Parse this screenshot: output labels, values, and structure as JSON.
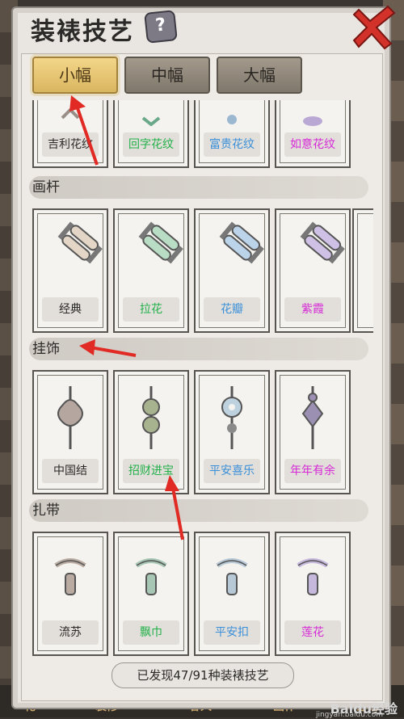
{
  "title": "装裱技艺",
  "help_symbol": "?",
  "tabs": [
    {
      "label": "小幅",
      "active": true
    },
    {
      "label": "中幅",
      "active": false
    },
    {
      "label": "大幅",
      "active": false
    }
  ],
  "top_row": [
    {
      "name": "吉利花纹",
      "color": "#2c2a28"
    },
    {
      "name": "回字花纹",
      "color": "#23b04a"
    },
    {
      "name": "富贵花纹",
      "color": "#3a8fd8"
    },
    {
      "name": "如意花纹",
      "color": "#d62ad6"
    }
  ],
  "sections": [
    {
      "label": "画杆",
      "items": [
        {
          "name": "经典",
          "color": "#2c2a28",
          "art": "rod",
          "tint": "#e3d6c6"
        },
        {
          "name": "拉花",
          "color": "#23b04a",
          "art": "rod",
          "tint": "#b8dcc4"
        },
        {
          "name": "花瓣",
          "color": "#3a8fd8",
          "art": "rod",
          "tint": "#bcd4ea"
        },
        {
          "name": "紫霞",
          "color": "#d62ad6",
          "art": "rod",
          "tint": "#cfc0e6"
        }
      ]
    },
    {
      "label": "挂饰",
      "items": [
        {
          "name": "中国结",
          "color": "#2c2a28",
          "art": "knot",
          "tint": "#b6a6a0"
        },
        {
          "name": "招财进宝",
          "color": "#23b04a",
          "art": "coin",
          "tint": "#a7b28e"
        },
        {
          "name": "平安喜乐",
          "color": "#3a8fd8",
          "art": "disc",
          "tint": "#bed1df"
        },
        {
          "name": "年年有余",
          "color": "#d62ad6",
          "art": "pendant",
          "tint": "#9b8fb2"
        }
      ]
    },
    {
      "label": "扎带",
      "items": [
        {
          "name": "流苏",
          "color": "#2c2a28",
          "art": "ribbon",
          "tint": "#b9aba1"
        },
        {
          "name": "飘巾",
          "color": "#23b04a",
          "art": "ribbon",
          "tint": "#a7c6b3"
        },
        {
          "name": "平安扣",
          "color": "#3a8fd8",
          "art": "ribbon",
          "tint": "#b7c8d6"
        },
        {
          "name": "莲花",
          "color": "#d62ad6",
          "art": "ribbon",
          "tint": "#c6b8dc"
        }
      ]
    }
  ],
  "footer_text": "已发现47/91种装裱技艺",
  "bottom_strip": [
    "礼",
    "装修",
    "客人",
    "画作",
    "订铺"
  ],
  "watermark": "Baidu经验",
  "watermark_sub": "jingyan.baidu.com"
}
